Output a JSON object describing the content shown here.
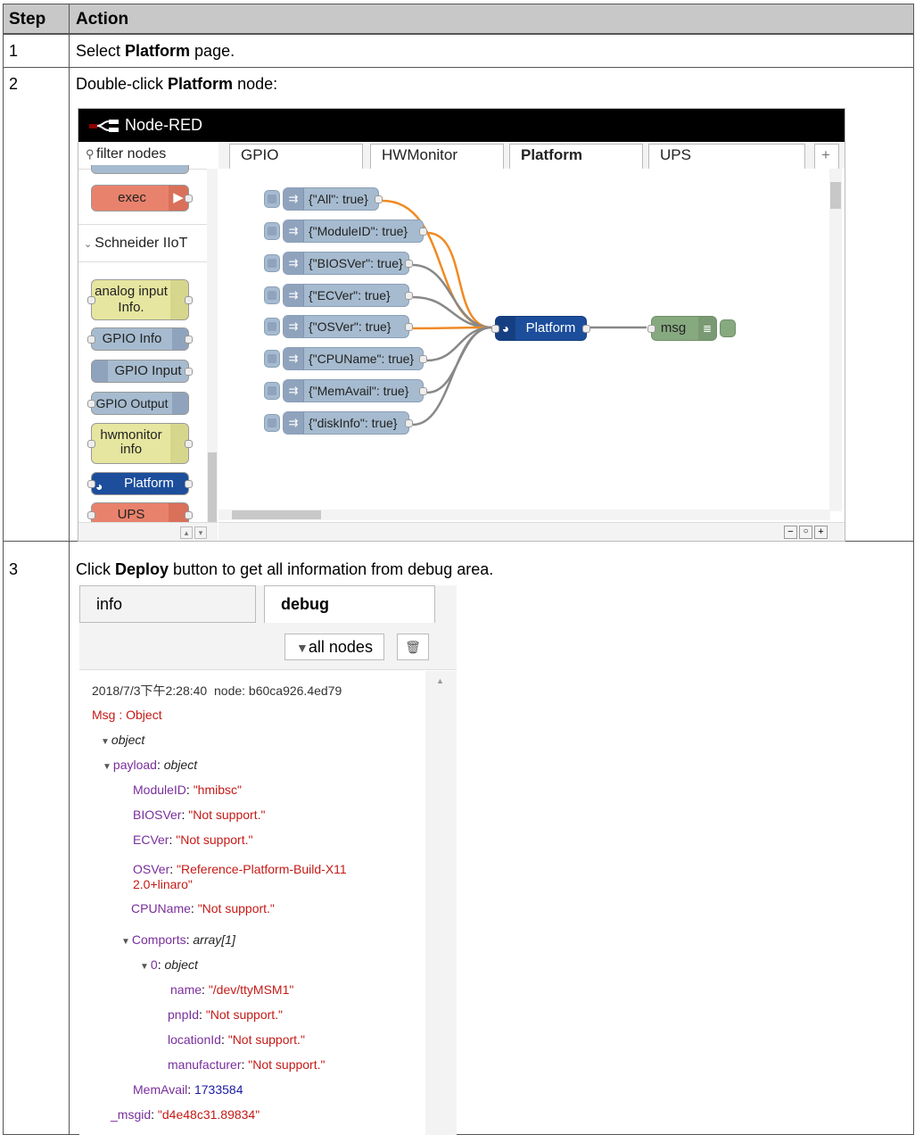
{
  "table": {
    "headers": [
      "Step",
      "Action"
    ],
    "rows": [
      {
        "step": "1",
        "pre": "Select ",
        "bold": "Platform",
        "post": " page."
      },
      {
        "step": "2",
        "pre": "Double-click ",
        "bold": "Platform",
        "post": " node:"
      },
      {
        "step": "3",
        "pre": "Click ",
        "bold": "Deploy",
        "post": " button to get all information from debug area."
      }
    ]
  },
  "nodered": {
    "title": "Node-RED",
    "filter_placeholder": "filter nodes",
    "tabs": [
      "GPIO",
      "HWMonitor",
      "Platform",
      "UPS"
    ],
    "active_tab": "Platform",
    "add_tab": "+",
    "palette": {
      "exec": "exec",
      "category": "Schneider IIoT",
      "nodes": [
        "analog input Info.",
        "GPIO Info",
        "GPIO Input",
        "GPIO Output",
        "hwmonitor info",
        "Platform",
        "UPS"
      ]
    },
    "inject_nodes": [
      "{\"All\": true}",
      "{\"ModuleID\": true}",
      "{\"BIOSVer\": true}",
      "{\"ECVer\": true}",
      "{\"OSVer\": true}",
      "{\"CPUName\": true}",
      "{\"MemAvail\": true}",
      "{\"diskInfo\": true}"
    ],
    "platform_node": "Platform",
    "debug_node": "msg",
    "colors": {
      "inject": "#a6bbcf",
      "platform": "#1c4e9c",
      "debug": "#87a980",
      "exec": "#e9826c",
      "yellow": "#e6e6a0",
      "wire_active": "#f08a24"
    }
  },
  "debug": {
    "tabs": [
      "info",
      "debug"
    ],
    "filter_label": "all nodes",
    "timestamp": "2018/7/3下午2:28:40",
    "node_label": "node: b60ca926.4ed79",
    "msg_label": "Msg : Object",
    "tree": {
      "object": "object",
      "payload_key": "payload",
      "payload_type": "object",
      "module_key": "ModuleID",
      "module_val": "\"hmibsc\"",
      "bios_key": "BIOSVer",
      "bios_val": "\"Not support.\"",
      "ec_key": "ECVer",
      "ec_val": "\"Not support.\"",
      "os_key": "OSVer",
      "os_val_1": "\"Reference-Platform-Build-X11",
      "os_val_2": "2.0+linaro\"",
      "cpu_key": "CPUName",
      "cpu_val": "\"Not support.\"",
      "comports_key": "Comports",
      "comports_type": "array[1]",
      "idx_key": "0",
      "idx_type": "object",
      "name_key": "name",
      "name_val": "\"/dev/ttyMSM1\"",
      "pnp_key": "pnpId",
      "pnp_val": "\"Not support.\"",
      "loc_key": "locationId",
      "loc_val": "\"Not support.\"",
      "manu_key": "manufacturer",
      "manu_val": "\"Not support.\"",
      "mem_key": "MemAvail",
      "mem_val": "1733584",
      "msgid_key": "_msgid",
      "msgid_val": "\"d4e48c31.89834\""
    }
  }
}
